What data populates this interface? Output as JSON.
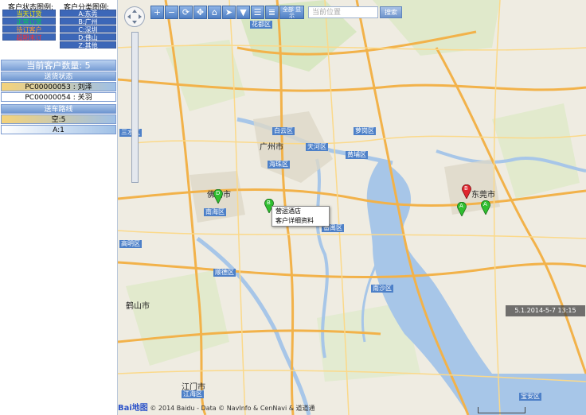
{
  "legend": {
    "status_title": "客户状态图例:",
    "category_title": "客户分类图例:",
    "status_items": [
      {
        "label": "当天订货",
        "color": "#f2e600"
      },
      {
        "label": "正常订货",
        "color": "#00d64a"
      },
      {
        "label": "待订客户",
        "color": "#ff9a2e"
      },
      {
        "label": "超期未订",
        "color": "#ff2e2e"
      }
    ],
    "category_items": [
      {
        "label": "A:东莞"
      },
      {
        "label": "B:广州"
      },
      {
        "label": "C:深圳"
      },
      {
        "label": "D:佛山"
      },
      {
        "label": "Z:其他"
      }
    ]
  },
  "customer_count": "当前客户数量: 5",
  "route_status": {
    "header": "送货状态",
    "items": [
      "PC00000053 : 刘泽",
      "PC00000054 : 关羽"
    ]
  },
  "vehicle_route": {
    "header": "送车路线",
    "items": [
      "空:5",
      "A:1"
    ]
  },
  "search": {
    "placeholder": "当前位置",
    "button": "搜索"
  },
  "toolbar": {
    "buttons": [
      "zoom-in",
      "zoom-out",
      "refresh",
      "pan",
      "home",
      "direction",
      "filter",
      "list-view",
      "detail-view"
    ],
    "wide_button": "全部 显示"
  },
  "context_menu": {
    "items": [
      "营运酒店",
      "客户详细资料"
    ]
  },
  "timestamp": "5.1.2014-5-7 13:15",
  "copyright": {
    "logo": "Bai地图",
    "text": "© 2014 Baidu - Data © NavInfo & CenNavi & 道道通"
  },
  "map_labels": {
    "cities": [
      "广州市",
      "佛山市",
      "东莞市",
      "江门市",
      "鹤山市"
    ],
    "districts": [
      "花都区",
      "白云区",
      "天河区",
      "海珠区",
      "黄埔区",
      "萝岗区",
      "番禺区",
      "南沙区",
      "顺德区",
      "三水区",
      "高明区",
      "江海区",
      "南海区",
      "宝安区"
    ]
  },
  "markers": [
    {
      "label": "D",
      "color": "#2fbf2f"
    },
    {
      "label": "B",
      "color": "#2fbf2f"
    },
    {
      "label": "B",
      "color": "#e0262e"
    },
    {
      "label": "A",
      "color": "#2fbf2f"
    },
    {
      "label": "A",
      "color": "#2fbf2f"
    }
  ]
}
